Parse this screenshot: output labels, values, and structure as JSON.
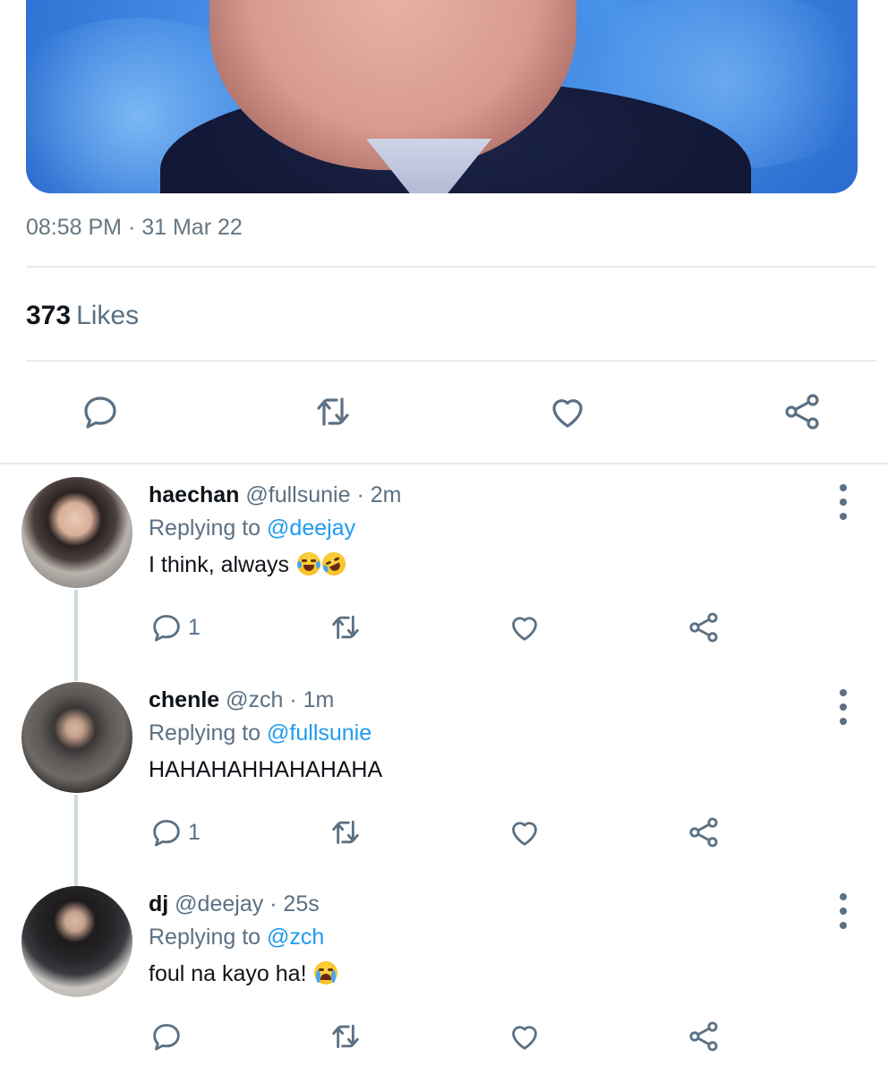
{
  "tweet": {
    "timestamp": "08:58 PM · 31 Mar 22",
    "likes_count": "373",
    "likes_label": "Likes",
    "actions": [
      "reply-icon",
      "retweet-icon",
      "like-icon",
      "share-icon"
    ]
  },
  "replies": [
    {
      "display_name": "haechan",
      "handle_time": "@fullsunie · 2m",
      "replying_prefix": "Replying to",
      "replying_to": "@deejay",
      "text": "I think, always",
      "emoji": [
        "face-with-tears-of-joy",
        "rolling-on-the-floor-laughing"
      ],
      "reply_count": "1"
    },
    {
      "display_name": "chenle",
      "handle_time": "@zch · 1m",
      "replying_prefix": "Replying to",
      "replying_to": "@fullsunie",
      "text": "HAHAHAHHAHAHAHA",
      "emoji": [],
      "reply_count": "1"
    },
    {
      "display_name": "dj",
      "handle_time": "@deejay · 25s",
      "replying_prefix": "Replying to",
      "replying_to": "@zch",
      "text": "foul na kayo ha!",
      "emoji": [
        "loudly-crying-face"
      ],
      "reply_count": ""
    }
  ],
  "colors": {
    "accent": "#1d9bf0",
    "secondary_text": "#5b7083",
    "divider": "#e6ecf0"
  }
}
